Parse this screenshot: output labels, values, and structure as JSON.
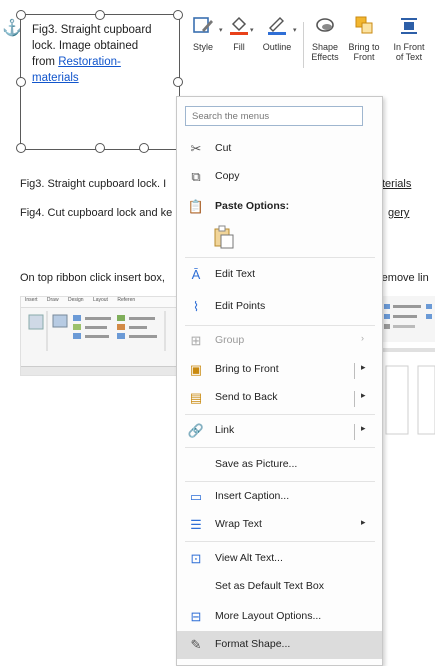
{
  "textbox": {
    "line1": "Fig3. Straight cupboard",
    "line2": "lock. Image obtained",
    "line3_prefix": "from ",
    "link1": "Restoration-",
    "link2": "materials"
  },
  "ribbon": {
    "style": "Style",
    "fill": "Fill",
    "outline": "Outline",
    "shape_effects_1": "Shape",
    "shape_effects_2": "Effects",
    "bring_front_1": "Bring to",
    "bring_front_2": "Front",
    "in_front_1": "In Front",
    "in_front_2": "of Text"
  },
  "doc": {
    "fig3_caption": "Fig3. Straight cupboard lock. I",
    "fig3_link": "terials",
    "fig4_caption": "Fig4. Cut cupboard lock and ke",
    "fig4_link": "gery",
    "instruction": "On top ribbon click insert box,",
    "instruction_tail": "remove lin"
  },
  "mini_screenshot": {
    "tabs": [
      "Insert",
      "Draw",
      "Design",
      "Layout",
      "Referen"
    ]
  },
  "context_menu": {
    "search_placeholder": "Search the menus",
    "items": {
      "cut": "Cut",
      "copy": "Copy",
      "paste_options": "Paste Options:",
      "edit_text": "Edit Text",
      "edit_points": "Edit Points",
      "group": "Group",
      "bring_to_front": "Bring to Front",
      "send_to_back": "Send to Back",
      "link": "Link",
      "save_as_picture": "Save as Picture...",
      "insert_caption": "Insert Caption...",
      "wrap_text": "Wrap Text",
      "view_alt_text": "View Alt Text...",
      "set_default": "Set as Default Text Box",
      "more_layout": "More Layout Options...",
      "format_shape": "Format Shape..."
    }
  },
  "colors": {
    "link": "#1155cc",
    "fill_accent": "#e8411a",
    "outline_accent": "#2f6fd6",
    "bring_front_accent": "#f2b62f",
    "highlight": "#dcdcdc"
  }
}
